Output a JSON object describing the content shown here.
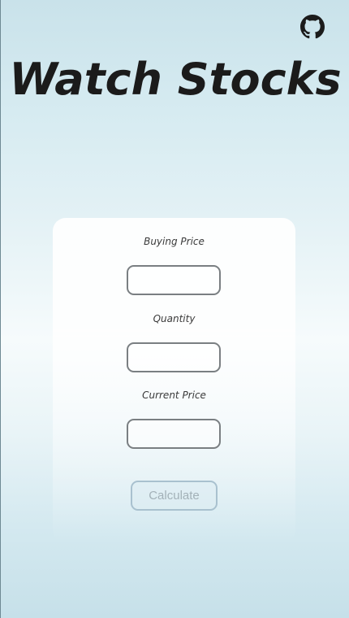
{
  "header": {
    "github_icon": "github-icon",
    "title": "Watch Stocks"
  },
  "form": {
    "buying_price": {
      "label": "Buying Price",
      "value": "",
      "placeholder": ""
    },
    "quantity": {
      "label": "Quantity",
      "value": "",
      "placeholder": ""
    },
    "current_price": {
      "label": "Current Price",
      "value": "",
      "placeholder": ""
    },
    "calculate_label": "Calculate"
  },
  "colors": {
    "title": "#1b1b1b",
    "background_top": "#c9e2ea",
    "background_mid": "#f6fbfc",
    "input_border": "#7a7f82",
    "button_border": "#a9c1cf",
    "button_text": "#a3b1b8"
  }
}
